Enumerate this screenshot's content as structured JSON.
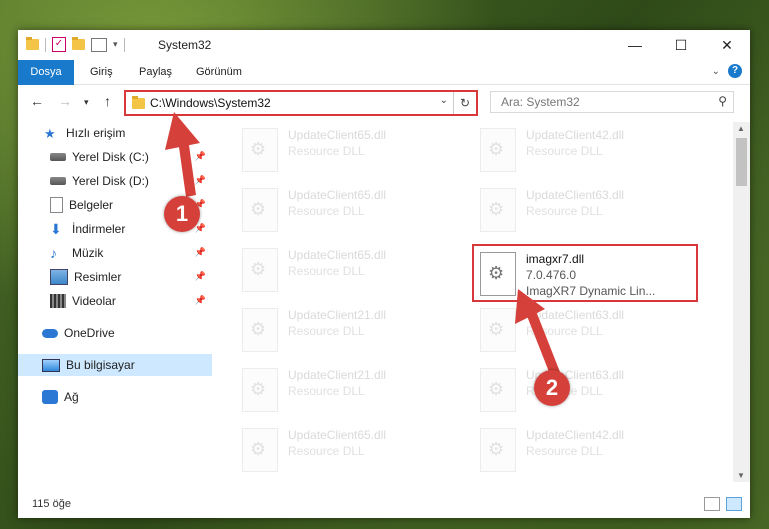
{
  "window": {
    "title": "System32"
  },
  "ribbon": {
    "tabs": [
      "Dosya",
      "Giriş",
      "Paylaş",
      "Görünüm"
    ]
  },
  "address": {
    "path": "C:\\Windows\\System32"
  },
  "search": {
    "placeholder": "Ara: System32"
  },
  "sidebar": {
    "items": [
      {
        "label": "Hızlı erişim",
        "icon": "star-icon"
      },
      {
        "label": "Yerel Disk (C:)",
        "icon": "drive-icon",
        "pinned": true
      },
      {
        "label": "Yerel Disk (D:)",
        "icon": "drive-icon",
        "pinned": true
      },
      {
        "label": "Belgeler",
        "icon": "documents-icon",
        "pinned": true
      },
      {
        "label": "İndirmeler",
        "icon": "downloads-icon",
        "pinned": true
      },
      {
        "label": "Müzik",
        "icon": "music-icon",
        "pinned": true
      },
      {
        "label": "Resimler",
        "icon": "pictures-icon",
        "pinned": true
      },
      {
        "label": "Videolar",
        "icon": "videos-icon",
        "pinned": true
      },
      {
        "label": "OneDrive",
        "icon": "onedrive-icon"
      },
      {
        "label": "Bu bilgisayar",
        "icon": "this-pc-icon",
        "selected": true
      },
      {
        "label": "Ağ",
        "icon": "network-icon"
      }
    ]
  },
  "files": [
    {
      "name": "UpdateClient65.dll",
      "desc": "Resource DLL"
    },
    {
      "name": "UpdateClient42.dll",
      "desc": "Resource DLL"
    },
    {
      "name": "UpdateClient65.dll",
      "desc": "Resource DLL"
    },
    {
      "name": "UpdateClient63.dll",
      "desc": "Resource DLL"
    },
    {
      "name": "UpdateClient65.dll",
      "desc": "Resource DLL"
    },
    {
      "name": "imagxr7.dll",
      "version": "7.0.476.0",
      "desc": "ImagXR7 Dynamic Lin..."
    },
    {
      "name": "UpdateClient21.dll",
      "desc": "Resource DLL"
    },
    {
      "name": "UpdateClient63.dll",
      "desc": "Resource DLL"
    },
    {
      "name": "UpdateClient21.dll",
      "desc": "Resource DLL"
    },
    {
      "name": "UpdateClient63.dll",
      "desc": "Resource DLL"
    },
    {
      "name": "UpdateClient65.dll",
      "desc": "Resource DLL"
    },
    {
      "name": "UpdateClient42.dll",
      "desc": "Resource DLL"
    }
  ],
  "status": {
    "count": "115 öğe"
  },
  "annotations": {
    "step1": "1",
    "step2": "2"
  },
  "colors": {
    "accent": "#1979ca",
    "highlight": "#d9383a",
    "selected": "#cde8ff"
  }
}
